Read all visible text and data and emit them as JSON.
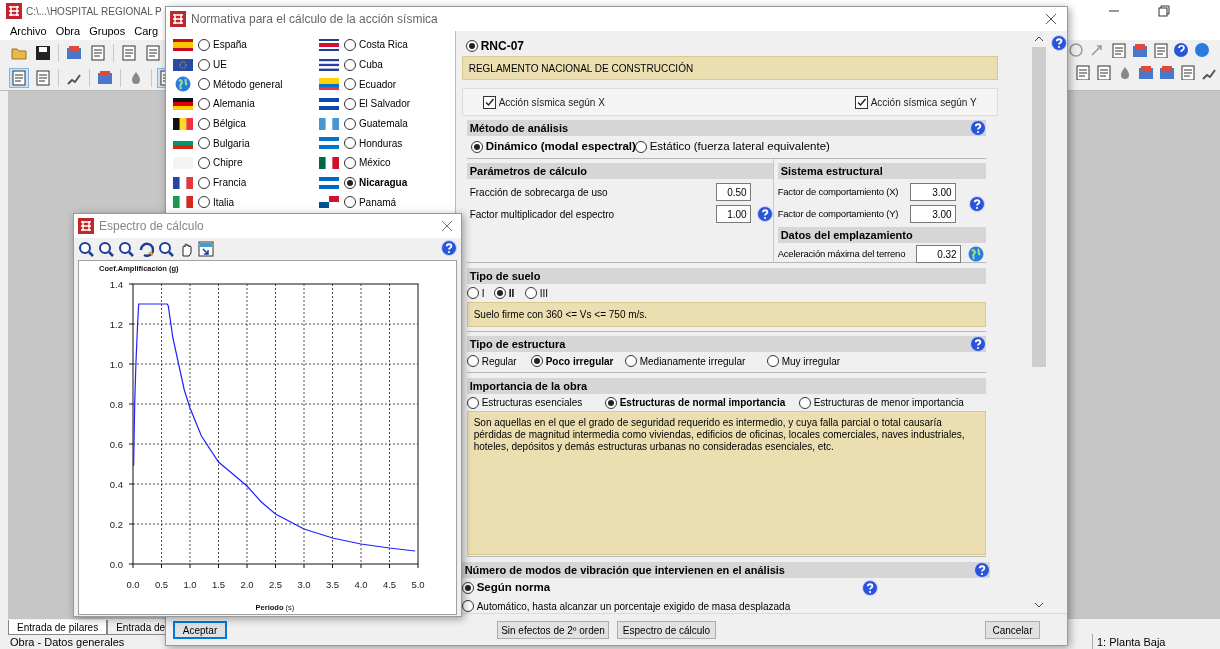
{
  "app": {
    "title": "C:\\...\\HOSPITAL REGIONAL P",
    "menu": [
      "Archivo",
      "Obra",
      "Grupos",
      "Carg"
    ],
    "tabs": [
      "Entrada de pilares",
      "Entrada de"
    ],
    "status": "Obra - Datos generales",
    "floor": "1: Planta Baja"
  },
  "normativa": {
    "title": "Normativa para el cálculo de la acción sísmica",
    "countries": [
      {
        "label": "España",
        "selected": false
      },
      {
        "label": "UE",
        "selected": false
      },
      {
        "label": "Método general",
        "selected": false
      },
      {
        "label": "Alemania",
        "selected": false
      },
      {
        "label": "Bélgica",
        "selected": false
      },
      {
        "label": "Bulgaria",
        "selected": false
      },
      {
        "label": "Chipre",
        "selected": false
      },
      {
        "label": "Francia",
        "selected": false
      },
      {
        "label": "Italia",
        "selected": false
      },
      {
        "label": "Costa Rica",
        "selected": false
      },
      {
        "label": "Cuba",
        "selected": false
      },
      {
        "label": "Ecuador",
        "selected": false
      },
      {
        "label": "El Salvador",
        "selected": false
      },
      {
        "label": "Guatemala",
        "selected": false
      },
      {
        "label": "Honduras",
        "selected": false
      },
      {
        "label": "México",
        "selected": false
      },
      {
        "label": "Nicaragua",
        "selected": true
      },
      {
        "label": "Panamá",
        "selected": false
      }
    ],
    "code": {
      "label": "RNC-07",
      "selected": true
    },
    "code_name": "REGLAMENTO NACIONAL DE CONSTRUCCIÓN",
    "checks": [
      {
        "label": "Acción sísmica según X",
        "checked": true
      },
      {
        "label": "Acción sísmica según Y",
        "checked": true
      }
    ],
    "analysis": {
      "title": "Método de análisis",
      "options": [
        {
          "label": "Dinámico (modal espectral)",
          "selected": true
        },
        {
          "label": "Estático (fuerza lateral equivalente)",
          "selected": false
        }
      ]
    },
    "parameters": {
      "title": "Parámetros de cálculo",
      "fields": [
        {
          "label": "Fracción de sobrecarga de uso",
          "value": "0.50"
        },
        {
          "label": "Factor multiplicador del espectro",
          "value": "1.00"
        }
      ]
    },
    "structural_system": {
      "title": "Sistema estructural",
      "fields": [
        {
          "label": "Factor de comportamiento (X)",
          "value": "3.00"
        },
        {
          "label": "Factor de comportamiento (Y)",
          "value": "3.00"
        }
      ]
    },
    "site": {
      "title": "Datos del emplazamiento",
      "fields": [
        {
          "label": "Aceleración máxima del terreno",
          "value": "0.32"
        }
      ]
    },
    "soil": {
      "title": "Tipo de suelo",
      "options": [
        {
          "label": "I",
          "selected": false
        },
        {
          "label": "II",
          "selected": true
        },
        {
          "label": "III",
          "selected": false
        }
      ],
      "description": "Suelo firme con 360 <= Vs <= 750 m/s."
    },
    "structure_type": {
      "title": "Tipo de estructura",
      "options": [
        {
          "label": "Regular",
          "selected": false
        },
        {
          "label": "Poco irregular",
          "selected": true
        },
        {
          "label": "Medianamente irregular",
          "selected": false
        },
        {
          "label": "Muy irregular",
          "selected": false
        }
      ]
    },
    "importance": {
      "title": "Importancia de la obra",
      "options": [
        {
          "label": "Estructuras esenciales",
          "selected": false
        },
        {
          "label": "Estructuras de normal importancia",
          "selected": true
        },
        {
          "label": "Estructuras de menor importancia",
          "selected": false
        }
      ],
      "description": "Son aquellas en el que el grado de seguridad requerido es intermedio, y cuya falla parcial o total causaría pérdidas de magnitud intermedia como viviendas, edificios de oficinas, locales comerciales, naves industriales, hoteles, depósitos y demás estructuras urbanas no consideradas esenciales, etc."
    },
    "modes": {
      "title": "Número de modos de vibración que intervienen en el análisis",
      "options": [
        {
          "label": "Según norma",
          "selected": true
        },
        {
          "label": "Automático, hasta alcanzar un porcentaje exigido de masa desplazada",
          "selected": false
        }
      ]
    },
    "buttons": [
      {
        "label": "Aceptar",
        "default": true
      },
      {
        "label": "Sin efectos de 2º orden",
        "default": false
      },
      {
        "label": "Espectro de cálculo",
        "default": false
      },
      {
        "label": "Cancelar",
        "default": false
      }
    ]
  },
  "spectrum": {
    "title": "Espectro de cálculo",
    "chart_data": {
      "type": "line",
      "grid": true,
      "xlabel": "**Periodo** (s)",
      "ylabel": "Coef.Amplificación (g)",
      "x": [
        0.01,
        0.03,
        0.05,
        0.08,
        0.1,
        0.6,
        0.62,
        0.7,
        0.8,
        0.9,
        1.0,
        1.2,
        1.5,
        1.75,
        2.0,
        2.25,
        2.5,
        3.0,
        3.5,
        4.0,
        4.5,
        4.95
      ],
      "series": [
        {
          "color": "#2020ff",
          "values": [
            0.49,
            0.8,
            1.0,
            1.2,
            1.3,
            1.3,
            1.29,
            1.13,
            1.0,
            0.87,
            0.78,
            0.64,
            0.51,
            0.45,
            0.39,
            0.31,
            0.25,
            0.175,
            0.13,
            0.1,
            0.08,
            0.065
          ]
        }
      ],
      "xlim": [
        0,
        5
      ],
      "ylim": [
        0,
        1.4
      ],
      "xticks": [
        {
          "value": 0,
          "label": "0.0"
        },
        {
          "value": 0.5,
          "label": "0.5"
        },
        {
          "value": 1,
          "label": "1.0"
        },
        {
          "value": 1.5,
          "label": "1.5"
        },
        {
          "value": 2,
          "label": "2.0"
        },
        {
          "value": 2.5,
          "label": "2.5"
        },
        {
          "value": 3,
          "label": "3.0"
        },
        {
          "value": 3.5,
          "label": "3.5"
        },
        {
          "value": 4,
          "label": "4.0"
        },
        {
          "value": 4.5,
          "label": "4.5"
        },
        {
          "value": 5,
          "label": "5.0"
        }
      ],
      "yticks": [
        {
          "value": 0,
          "label": "0.0"
        },
        {
          "value": 0.2,
          "label": "0.2"
        },
        {
          "value": 0.4,
          "label": "0.4"
        },
        {
          "value": 0.6,
          "label": "0.6"
        },
        {
          "value": 0.8,
          "label": "0.8"
        },
        {
          "value": 1,
          "label": "1.0"
        },
        {
          "value": 1.2,
          "label": "1.2"
        },
        {
          "value": 1.4,
          "label": "1.4"
        }
      ]
    }
  }
}
